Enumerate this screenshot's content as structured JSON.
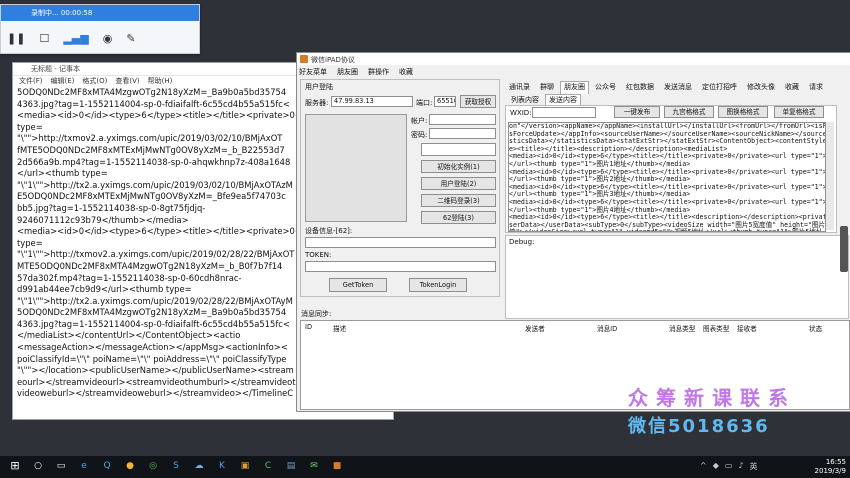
{
  "recorder": {
    "status": "录制中... 00:00:58",
    "icons": [
      "pause-icon",
      "stop-icon",
      "audio-level-icon",
      "camera-icon",
      "pen-icon"
    ]
  },
  "notepad": {
    "title": "无标题 - 记事本",
    "menu": [
      "文件(F)",
      "编辑(E)",
      "格式(O)",
      "查看(V)",
      "帮助(H)"
    ],
    "lines": [
      "5ODQ0NDc2MF8xMTA4MzgwOTg2N18yXzM=_Ba9b0a5bd35754",
      "4363.jpg?tag=1-1552114004-sp-0-fdiaifalft-6c55cd4b55a515fc<",
      "<media><id>0</id><type>6</type><title></title><private>0<",
      "type=",
      "\"\\\"\">http://txmov2.a.yximgs.com/upic/2019/03/02/10/BMjAxOT",
      "fMTE5ODQ0NDc2MF8xMTExMjMwNTg0OV8yXzM=_b_B22553d7",
      "2d566a9b.mp4?tag=1-1552114038-sp-0-ahqwkhnp7z-408a1648",
      "</url><thumb type=",
      "\"\\\"1\\\"\">http://tx2.a.yximgs.com/upic/2019/03/02/10/BMjAxOTAzM",
      "E5ODQ0NDc2MF8xMTExMjMwNTg0OV8yXzM=_Bfe9ea5f74703c",
      "bb5.jpg?tag=1-1552114038-sp-0-8gt75fjdjq-",
      "9246071112c93b79</thumb></media>",
      "<media><id>0</id><type>6</type><title></title><private>0<",
      "type=",
      "\"\\\"1\\\"\">http://txmov2.a.yximgs.com/upic/2019/02/28/22/BMjAxOT",
      "MTE5ODQ0NDc2MF8xMTA4MzgwOTg2N18yXzM=_b_B0f7b7f14",
      "57da302f.mp4?tag=1-1552114038-sp-0-60cdh8nrac-",
      "d991ab44ee7cb9d9</url><thumb type=",
      "\"\\\"1\\\"\">http://tx2.a.yximgs.com/upic/2019/02/28/22/BMjAxOTAyM",
      "5ODQ0NDc2MF8xMTA4MzgwOTg2N18yXzM=_Ba9b0a5bd35754",
      "4363.jpg?tag=1-1552114004-sp-0-fdiaifalft-6c55cd4b55a515fc<",
      "</mediaList></contentUrl></ContentObject><actio",
      "<messageAction></messageAction></appMsg><actionInfo><",
      "poiClassifyId=\\\"\\\" poiName=\\\"\\\" poiAddress=\\\"\\\" poiClassifyType",
      "\"\\\"\"></location><publicUserName></publicUserName><stream",
      "eourl></streamvideourl><streamvideothumburl></streamvideot",
      "videoweburl></streamvideoweburl></streamvideo></TimelineC"
    ]
  },
  "proto": {
    "title": "微信iPAD协议",
    "menu": [
      "好友菜单",
      "朋友圈",
      "群操作",
      "收藏"
    ],
    "login_group": "用户登陆",
    "server_label": "服务器:",
    "server_value": "47.99.83.13",
    "port_label": "端口:",
    "port_value": "65510",
    "get_auth": "获取授权",
    "account_label": "帐户:",
    "password_label": "密码:",
    "init_btn": "初始化实例(1)",
    "user_login": "用户登陆(2)",
    "qr_login": "二维码登录(3)",
    "login62": "62登陆(3)",
    "device_label": "设备信息-[62]:",
    "token_label": "TOKEN:",
    "get_token": "GetToken",
    "token_login": "TokenLogin",
    "msg_sync": "消息同步:",
    "top_tabs": [
      "通讯录",
      "群聊",
      "朋友圈",
      "公众号",
      "红包数据",
      "发送消息",
      "定位打招呼",
      "修改头像",
      "收藏",
      "请求"
    ],
    "sub_tabs": [
      "列表内容",
      "发送内容"
    ],
    "wxid_label": "WXID:",
    "fmt_btns": [
      "一键发布",
      "九宫格格式",
      "图换格格式",
      "单复格格式"
    ],
    "xml_lines": [
      "on\"</version><appName></appName><installUrl></installUrl><fromUrl></fromUrl><isForceUpdate>0</i",
      "sForceUpdate></appInfo><sourceUserName></sourceUserName><sourceNickName></sourceNickName><stati",
      "sticsData></statisticsData><statExtStr></statExtStr><ContentObject><contentStyle>6</contentSty",
      "e><title></title><description></description><mediaList>",
      "<media><id>0</id><type>6</type><title></title><private>0</private><url type=\"1\">视频2地址",
      "</url><thumb type=\"1\">图片1地址</thumb></media>",
      "<media><id>0</id><type>6</type><title></title><private>0</private><url type=\"1\">视频2地址",
      "</url><thumb type=\"1\">图片2地址</thumb></media>",
      "<media><id>0</id><type>6</type><title></title><private>0</private><url type=\"1\">视频3地址",
      "</url><thumb type=\"1\">图片3地址</thumb></media>",
      "<media><id>0</id><type>6</type><title></title><private>0</private><url type=\"1\">视频4地址",
      "</url><thumb type=\"1\">图片4地址</thumb></media>",
      "<media><id>0</id><type>6</type><title></title><description></description><private>0</private><u",
      "serData></userData><subType>0</subType><videoSize width=\"图片5宽度值\" height=\"图片5高度",
      "值\"></videoSize><url type=\"1\" videomd5=\"\">视频5地址</url><thumb type=\"1\">图片5地址"
    ],
    "debug_label": "Debug:",
    "grid_cols": [
      "ID",
      "描述",
      "发送者",
      "消息ID",
      "消息类型",
      "图表类型",
      "接收者",
      "状态"
    ]
  },
  "watermark": {
    "line1": "众筹新课联系",
    "line2": "微信5018636"
  },
  "taskbar": {
    "time": "16:55",
    "date": "2019/3/9",
    "lang": "英"
  }
}
